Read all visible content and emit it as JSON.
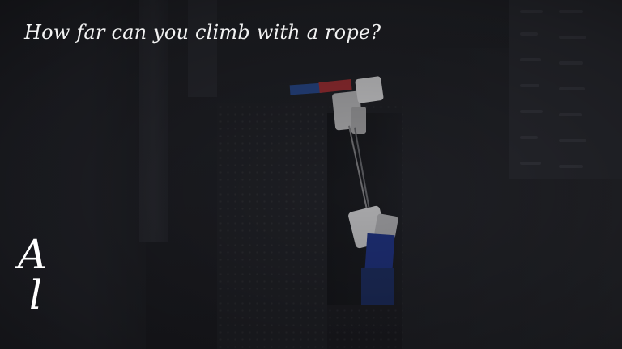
{
  "overlay": {
    "title": "How far can you climb with a rope?",
    "logo": {
      "letter_top": "A",
      "letter_bottom": "l"
    }
  },
  "colors": {
    "background": "#1b1c20",
    "text": "#f2f2f2",
    "rope": "#6b6b6e",
    "arm_blue": "#24407a",
    "arm_red": "#8a2a2e",
    "torso_blue": "#1c2c6e"
  }
}
